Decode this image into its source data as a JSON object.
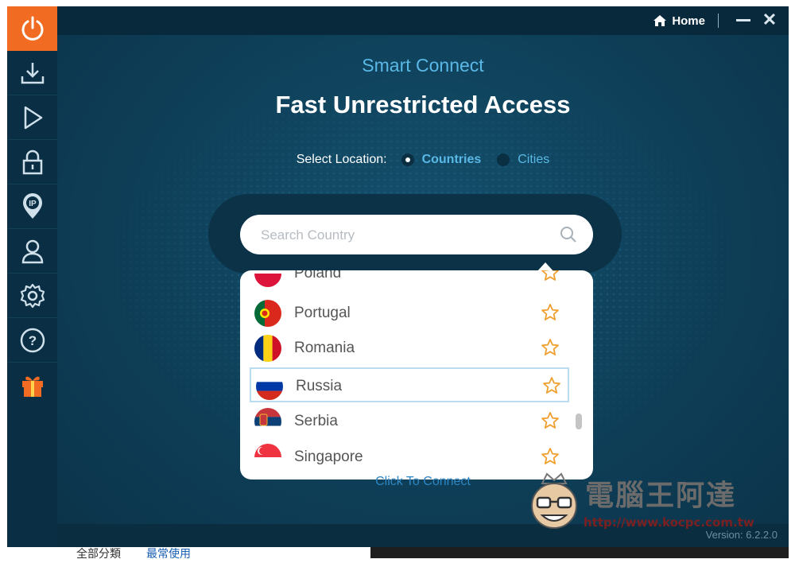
{
  "window": {
    "home_label": "Home",
    "minimize_icon": "minimize-icon",
    "close_icon": "close-icon"
  },
  "sidebar": {
    "items": [
      {
        "name": "power-icon",
        "active": true
      },
      {
        "name": "download-icon"
      },
      {
        "name": "play-icon"
      },
      {
        "name": "lock-icon"
      },
      {
        "name": "ip-location-icon"
      },
      {
        "name": "user-icon"
      },
      {
        "name": "gear-icon"
      },
      {
        "name": "help-icon"
      },
      {
        "name": "gift-icon"
      }
    ]
  },
  "main": {
    "subtitle": "Smart Connect",
    "headline": "Fast Unrestricted Access",
    "location": {
      "label": "Select Location:",
      "options": [
        "Countries",
        "Cities"
      ],
      "selected": "Countries"
    },
    "search": {
      "placeholder": "Search Country",
      "value": ""
    },
    "countries": [
      {
        "name": "Poland",
        "favorite": false
      },
      {
        "name": "Portugal",
        "favorite": false
      },
      {
        "name": "Romania",
        "favorite": false
      },
      {
        "name": "Russia",
        "favorite": false,
        "selected": true
      },
      {
        "name": "Serbia",
        "favorite": false
      },
      {
        "name": "Singapore",
        "favorite": false
      }
    ],
    "connect_label": "Click To Connect",
    "version": "Version: 6.2.2.0"
  },
  "taskbar": {
    "text1": "全部分類",
    "text2": "最常使用"
  },
  "watermark": {
    "text": "電腦王阿達",
    "url": "http://www.kocpc.com.tw"
  },
  "colors": {
    "accent": "#f26b22",
    "background": "#0d3a52",
    "link": "#5ab8e6",
    "star": "#f0a030"
  }
}
